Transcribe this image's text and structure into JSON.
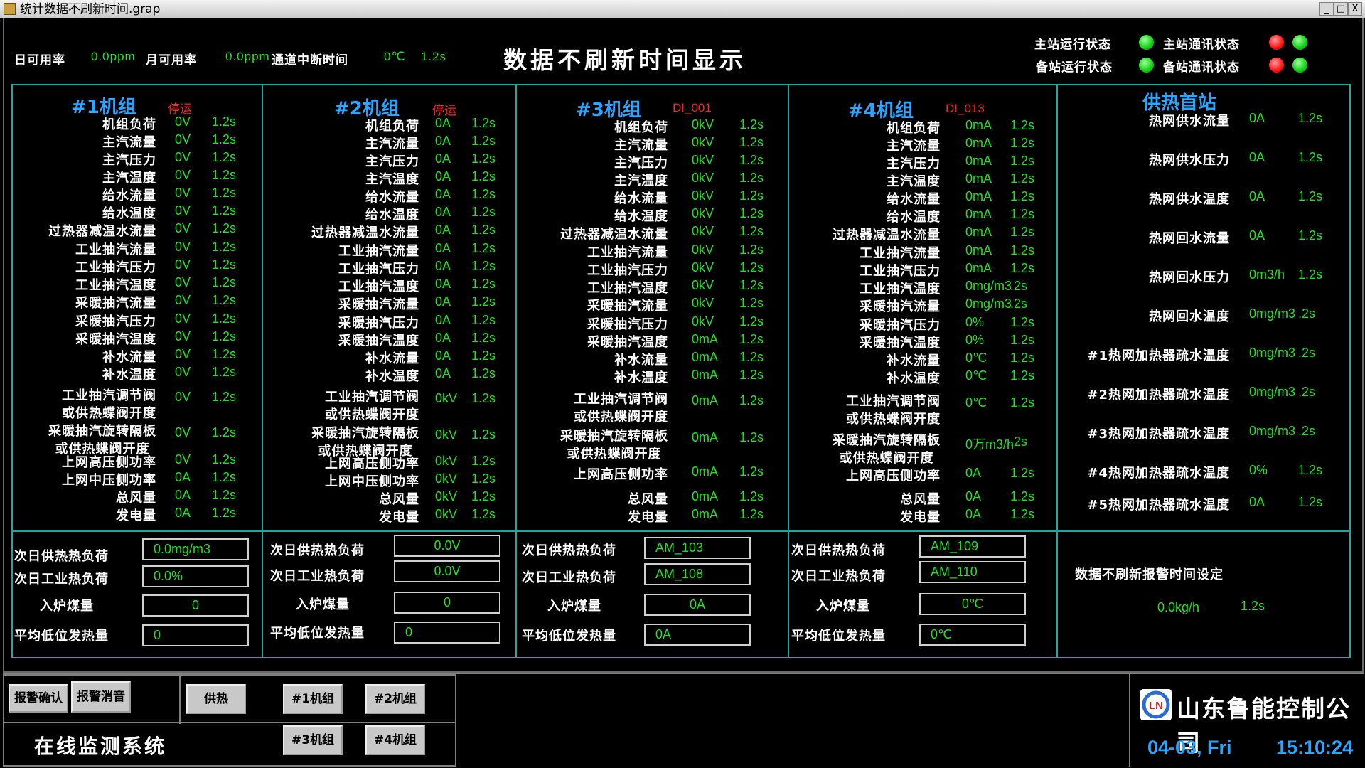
{
  "window": {
    "title": "统计数据不刷新时间.grap",
    "btn_min": "_",
    "btn_max": "□",
    "btn_close": "X"
  },
  "header": {
    "daily_label": "日可用率",
    "daily_value": "0.0ppm",
    "monthly_label": "月可用率",
    "monthly_value": "0.0ppm",
    "interrupt_label": "通道中断时间",
    "interrupt_value": "0℃",
    "interrupt_time": "1.2s",
    "title": "数据不刷新时间显示"
  },
  "status": {
    "main_run": "主站运行状态",
    "main_comm": "主站通讯状态",
    "backup_run": "备站运行状态",
    "backup_comm": "备站通讯状态"
  },
  "unit1": {
    "title": "#1机组",
    "state": "停运",
    "rows": [
      {
        "label": "机组负荷",
        "value": "0V",
        "time": "1.2s"
      },
      {
        "label": "主汽流量",
        "value": "0V",
        "time": "1.2s"
      },
      {
        "label": "主汽压力",
        "value": "0V",
        "time": "1.2s"
      },
      {
        "label": "主汽温度",
        "value": "0V",
        "time": "1.2s"
      },
      {
        "label": "给水流量",
        "value": "0V",
        "time": "1.2s"
      },
      {
        "label": "给水温度",
        "value": "0V",
        "time": "1.2s"
      },
      {
        "label": "过热器减温水流量",
        "value": "0V",
        "time": "1.2s"
      },
      {
        "label": "工业抽汽流量",
        "value": "0V",
        "time": "1.2s"
      },
      {
        "label": "工业抽汽压力",
        "value": "0V",
        "time": "1.2s"
      },
      {
        "label": "工业抽汽温度",
        "value": "0V",
        "time": "1.2s"
      },
      {
        "label": "采暖抽汽流量",
        "value": "0V",
        "time": "1.2s"
      },
      {
        "label": "采暖抽汽压力",
        "value": "0V",
        "time": "1.2s"
      },
      {
        "label": "采暖抽汽温度",
        "value": "0V",
        "time": "1.2s"
      },
      {
        "label": "补水流量",
        "value": "0V",
        "time": "1.2s"
      },
      {
        "label": "补水温度",
        "value": "0V",
        "time": "1.2s"
      },
      {
        "label": "工业抽汽调节阀\n或供热蝶阀开度",
        "value": "0V",
        "time": "1.2s"
      },
      {
        "label": "采暖抽汽旋转隔板\n或供热蝶阀开度",
        "value": "0V",
        "time": "1.2s"
      },
      {
        "label": "上网高压侧功率",
        "value": "0V",
        "time": "1.2s"
      },
      {
        "label": "上网中压侧功率",
        "value": "0A",
        "time": "1.2s"
      },
      {
        "label": "总风量",
        "value": "0A",
        "time": "1.2s"
      },
      {
        "label": "发电量",
        "value": "0A",
        "time": "1.2s"
      }
    ],
    "next_heat_label": "次日供热热负荷",
    "next_heat": "0.0mg/m3",
    "next_ind_label": "次日工业热负荷",
    "next_ind": "0.0%",
    "coal_label": "入炉煤量",
    "coal": "0",
    "lhv_label": "平均低位发热量",
    "lhv": "0"
  },
  "unit2": {
    "title": "#2机组",
    "state": "停运",
    "rows": [
      {
        "label": "机组负荷",
        "value": "0A",
        "time": "1.2s"
      },
      {
        "label": "主汽流量",
        "value": "0A",
        "time": "1.2s"
      },
      {
        "label": "主汽压力",
        "value": "0A",
        "time": "1.2s"
      },
      {
        "label": "主汽温度",
        "value": "0A",
        "time": "1.2s"
      },
      {
        "label": "给水流量",
        "value": "0A",
        "time": "1.2s"
      },
      {
        "label": "给水温度",
        "value": "0A",
        "time": "1.2s"
      },
      {
        "label": "过热器减温水流量",
        "value": "0A",
        "time": "1.2s"
      },
      {
        "label": "工业抽汽流量",
        "value": "0A",
        "time": "1.2s"
      },
      {
        "label": "工业抽汽压力",
        "value": "0A",
        "time": "1.2s"
      },
      {
        "label": "工业抽汽温度",
        "value": "0A",
        "time": "1.2s"
      },
      {
        "label": "采暖抽汽流量",
        "value": "0A",
        "time": "1.2s"
      },
      {
        "label": "采暖抽汽压力",
        "value": "0A",
        "time": "1.2s"
      },
      {
        "label": "采暖抽汽温度",
        "value": "0A",
        "time": "1.2s"
      },
      {
        "label": "补水流量",
        "value": "0A",
        "time": "1.2s"
      },
      {
        "label": "补水温度",
        "value": "0A",
        "time": "1.2s"
      },
      {
        "label": "工业抽汽调节阀\n或供热蝶阀开度",
        "value": "0kV",
        "time": "1.2s"
      },
      {
        "label": "采暖抽汽旋转隔板\n或供热蝶阀开度",
        "value": "0kV",
        "time": "1.2s"
      },
      {
        "label": "上网高压侧功率",
        "value": "0kV",
        "time": "1.2s"
      },
      {
        "label": "上网中压侧功率",
        "value": "0kV",
        "time": "1.2s"
      },
      {
        "label": "总风量",
        "value": "0kV",
        "time": "1.2s"
      },
      {
        "label": "发电量",
        "value": "0kV",
        "time": "1.2s"
      }
    ],
    "next_heat_label": "次日供热热负荷",
    "next_heat": "0.0V",
    "next_ind_label": "次日工业热负荷",
    "next_ind": "0.0V",
    "coal_label": "入炉煤量",
    "coal": "0",
    "lhv_label": "平均低位发热量",
    "lhv": "0"
  },
  "unit3": {
    "title": "#3机组",
    "state": "DI_001",
    "rows": [
      {
        "label": "机组负荷",
        "value": "0kV",
        "time": "1.2s"
      },
      {
        "label": "主汽流量",
        "value": "0kV",
        "time": "1.2s"
      },
      {
        "label": "主汽压力",
        "value": "0kV",
        "time": "1.2s"
      },
      {
        "label": "主汽温度",
        "value": "0kV",
        "time": "1.2s"
      },
      {
        "label": "给水流量",
        "value": "0kV",
        "time": "1.2s"
      },
      {
        "label": "给水温度",
        "value": "0kV",
        "time": "1.2s"
      },
      {
        "label": "过热器减温水流量",
        "value": "0kV",
        "time": "1.2s"
      },
      {
        "label": "工业抽汽流量",
        "value": "0kV",
        "time": "1.2s"
      },
      {
        "label": "工业抽汽压力",
        "value": "0kV",
        "time": "1.2s"
      },
      {
        "label": "工业抽汽温度",
        "value": "0kV",
        "time": "1.2s"
      },
      {
        "label": "采暖抽汽流量",
        "value": "0kV",
        "time": "1.2s"
      },
      {
        "label": "采暖抽汽压力",
        "value": "0kV",
        "time": "1.2s"
      },
      {
        "label": "采暖抽汽温度",
        "value": "0mA",
        "time": "1.2s"
      },
      {
        "label": "补水流量",
        "value": "0mA",
        "time": "1.2s"
      },
      {
        "label": "补水温度",
        "value": "0mA",
        "time": "1.2s"
      },
      {
        "label": "工业抽汽调节阀\n或供热蝶阀开度",
        "value": "0mA",
        "time": "1.2s"
      },
      {
        "label": "采暖抽汽旋转隔板\n或供热蝶阀开度",
        "value": "0mA",
        "time": "1.2s"
      },
      {
        "label": "上网高压侧功率",
        "value": "0mA",
        "time": "1.2s"
      },
      {
        "label": "总风量",
        "value": "0mA",
        "time": "1.2s"
      },
      {
        "label": "发电量",
        "value": "0mA",
        "time": "1.2s"
      }
    ],
    "next_heat_label": "次日供热热负荷",
    "next_heat": "AM_103",
    "next_ind_label": "次日工业热负荷",
    "next_ind": "AM_108",
    "coal_label": "入炉煤量",
    "coal": "0A",
    "lhv_label": "平均低位发热量",
    "lhv": "0A"
  },
  "unit4": {
    "title": "#4机组",
    "state": "DI_013",
    "rows": [
      {
        "label": "机组负荷",
        "value": "0mA",
        "time": "1.2s"
      },
      {
        "label": "主汽流量",
        "value": "0mA",
        "time": "1.2s"
      },
      {
        "label": "主汽压力",
        "value": "0mA",
        "time": "1.2s"
      },
      {
        "label": "主汽温度",
        "value": "0mA",
        "time": "1.2s"
      },
      {
        "label": "给水流量",
        "value": "0mA",
        "time": "1.2s"
      },
      {
        "label": "给水温度",
        "value": "0mA",
        "time": "1.2s"
      },
      {
        "label": "过热器减温水流量",
        "value": "0mA",
        "time": "1.2s"
      },
      {
        "label": "工业抽汽流量",
        "value": "0mA",
        "time": "1.2s"
      },
      {
        "label": "工业抽汽压力",
        "value": "0mA",
        "time": "1.2s"
      },
      {
        "label": "工业抽汽温度",
        "value": "0mg/m3",
        "time": ".2s"
      },
      {
        "label": "采暖抽汽流量",
        "value": "0mg/m3",
        "time": ".2s"
      },
      {
        "label": "采暖抽汽压力",
        "value": "0%",
        "time": "1.2s"
      },
      {
        "label": "采暖抽汽温度",
        "value": "0%",
        "time": "1.2s"
      },
      {
        "label": "补水流量",
        "value": "0℃",
        "time": "1.2s"
      },
      {
        "label": "补水温度",
        "value": "0℃",
        "time": "1.2s"
      },
      {
        "label": "工业抽汽调节阀\n或供热蝶阀开度",
        "value": "0℃",
        "time": "1.2s"
      },
      {
        "label": "采暖抽汽旋转隔板\n或供热蝶阀开度",
        "value": "0万m3/h",
        "time": ".2s"
      },
      {
        "label": "上网高压侧功率",
        "value": "0A",
        "time": "1.2s"
      },
      {
        "label": "总风量",
        "value": "0A",
        "time": "1.2s"
      },
      {
        "label": "发电量",
        "value": "0A",
        "time": "1.2s"
      }
    ],
    "next_heat_label": "次日供热热负荷",
    "next_heat": "AM_109",
    "next_ind_label": "次日工业热负荷",
    "next_ind": "AM_110",
    "coal_label": "入炉煤量",
    "coal": "0℃",
    "lhv_label": "平均低位发热量",
    "lhv": "0℃"
  },
  "station": {
    "title": "供热首站",
    "rows": [
      {
        "label": "热网供水流量",
        "value": "0A",
        "time": "1.2s"
      },
      {
        "label": "热网供水压力",
        "value": "0A",
        "time": "1.2s"
      },
      {
        "label": "热网供水温度",
        "value": "0A",
        "time": "1.2s"
      },
      {
        "label": "热网回水流量",
        "value": "0A",
        "time": "1.2s"
      },
      {
        "label": "热网回水压力",
        "value": "0m3/h",
        "time": "1.2s"
      },
      {
        "label": "热网回水温度",
        "value": "0mg/m3",
        "time": ".2s"
      },
      {
        "label": "#1热网加热器疏水温度",
        "value": "0mg/m3",
        "time": ".2s"
      },
      {
        "label": "#2热网加热器疏水温度",
        "value": "0mg/m3",
        "time": ".2s"
      },
      {
        "label": "#3热网加热器疏水温度",
        "value": "0mg/m3",
        "time": ".2s"
      },
      {
        "label": "#4热网加热器疏水温度",
        "value": "0%",
        "time": "1.2s"
      },
      {
        "label": "#5热网加热器疏水温度",
        "value": "0A",
        "time": "1.2s"
      }
    ],
    "alarm_label": "数据不刷新报警时间设定",
    "alarm_value": "0.0kg/h",
    "alarm_time": "1.2s"
  },
  "footer": {
    "ack": "报警确认",
    "silence": "报警消音",
    "heating": "供热",
    "u1": "#1机组",
    "u2": "#2机组",
    "u3": "#3机组",
    "u4": "#4机组",
    "system": "在线监测系统",
    "company": "山东鲁能控制公司",
    "logo_text": "LN",
    "date": "04-03, Fri",
    "time": "15:10:24"
  }
}
